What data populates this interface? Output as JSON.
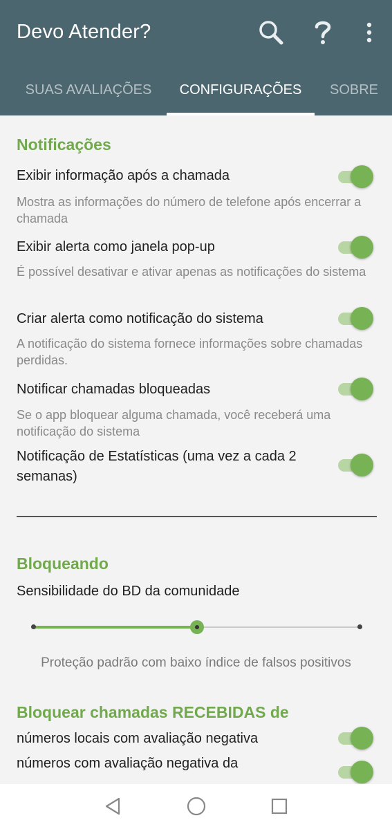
{
  "app_title": "Devo Atender?",
  "icons": {
    "search": "search-icon",
    "help": "help-icon",
    "more": "more-vert-icon"
  },
  "tabs": [
    {
      "label": "SUAS AVALIAÇÕES",
      "active": false
    },
    {
      "label": "CONFIGURAÇÕES",
      "active": true
    },
    {
      "label": "SOBRE",
      "active": false
    }
  ],
  "notifications": {
    "section_title": "Notificações",
    "items": [
      {
        "title": "Exibir informação após a chamada",
        "subtitle": "Mostra as informações do número de telefone após encerrar a chamada",
        "enabled": true
      },
      {
        "title": "Exibir alerta como janela pop-up",
        "subtitle": "É possível desativar e ativar apenas as notificações do sistema",
        "enabled": true
      },
      {
        "title": "Criar alerta como notificação do sistema",
        "subtitle": "A notificação do sistema fornece informações sobre chamadas perdidas.",
        "enabled": true
      },
      {
        "title": "Notificar chamadas bloqueadas",
        "subtitle": "Se o app bloquear alguma chamada, você receberá uma notificação do sistema",
        "enabled": true
      },
      {
        "title": "Notificação de Estatísticas (uma vez a cada 2 semanas)",
        "enabled": true
      }
    ]
  },
  "blocking": {
    "section_title": "Bloqueando",
    "sensitivity_label": "Sensibilidade do BD da comunidade",
    "sensitivity_level": 0.5,
    "sensitivity_steps": 3,
    "sensitivity_caption": "Proteção padrão com baixo índice de falsos positivos"
  },
  "block_incoming": {
    "section_title": "Bloquear chamadas RECEBIDAS de",
    "items": [
      {
        "title": "números locais com avaliação negativa",
        "enabled": true
      },
      {
        "title": "números com avaliação negativa da",
        "enabled": true
      }
    ]
  },
  "colors": {
    "appbar": "#4c6670",
    "accent": "#77b255",
    "background": "#f3f3f3"
  }
}
